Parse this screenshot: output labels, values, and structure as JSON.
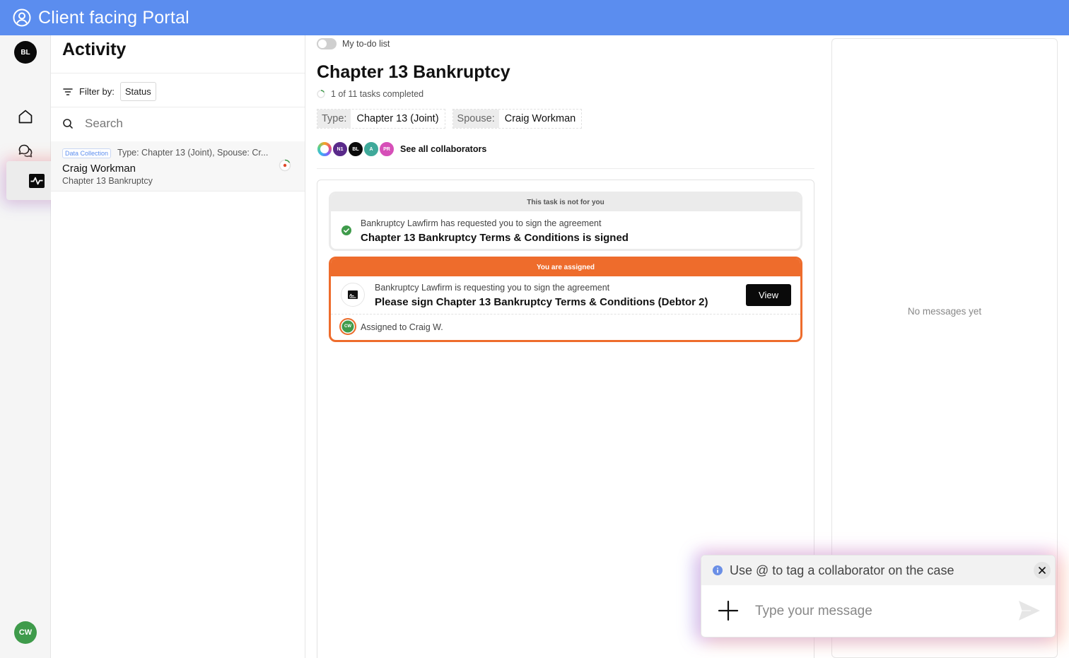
{
  "app": {
    "title": "Client facing Portal"
  },
  "nav": {
    "user_initials": "BL",
    "bottom_user_initials": "CW",
    "items": [
      {
        "icon": "home-icon"
      },
      {
        "icon": "chat-icon"
      },
      {
        "icon": "calendar-check-icon"
      },
      {
        "icon": "activity-icon",
        "active": true
      }
    ]
  },
  "activity": {
    "title": "Activity",
    "filter_label": "Filter by:",
    "filter_value": "Status",
    "search_placeholder": "Search",
    "items": [
      {
        "tag": "Data Collection",
        "meta": "Type: Chapter 13 (Joint), Spouse: Cr...",
        "name": "Craig Workman",
        "sub": "Chapter 13 Bankruptcy"
      }
    ]
  },
  "main": {
    "todo_label": "My to-do list",
    "case_title": "Chapter 13 Bankruptcy",
    "tasks_completed": "1 of 11 tasks completed",
    "chips": [
      {
        "key": "Type:",
        "value": "Chapter 13 (Joint)"
      },
      {
        "key": "Spouse:",
        "value": "Craig Workman"
      }
    ],
    "collaborators": [
      {
        "initials": "",
        "color": "#e8e8f0"
      },
      {
        "initials": "N1",
        "color": "#5a2a8a"
      },
      {
        "initials": "BL",
        "color": "#0a0a0a"
      },
      {
        "initials": "A",
        "color": "#3fa99a"
      },
      {
        "initials": "PR",
        "color": "#d64fb8"
      }
    ],
    "see_all_label": "See all collaborators",
    "task_done": {
      "header": "This task is not for you",
      "request": "Bankruptcy Lawfirm has requested you to sign the agreement",
      "title": "Chapter 13 Bankruptcy Terms & Conditions is signed"
    },
    "task_assigned": {
      "header": "You are assigned",
      "request": "Bankruptcy Lawfirm is requesting you to sign the agreement",
      "title": "Please sign Chapter 13 Bankruptcy Terms & Conditions (Debtor 2)",
      "view_label": "View",
      "assignee_initials": "CW",
      "assigned_label": "Assigned to Craig W."
    }
  },
  "messages": {
    "empty_label": "No messages yet",
    "hint": "Use @ to tag a collaborator on the case",
    "input_placeholder": "Type your message"
  },
  "colors": {
    "header": "#5b8def",
    "assigned_accent": "#ee6c2c",
    "success": "#3f9b4b"
  }
}
